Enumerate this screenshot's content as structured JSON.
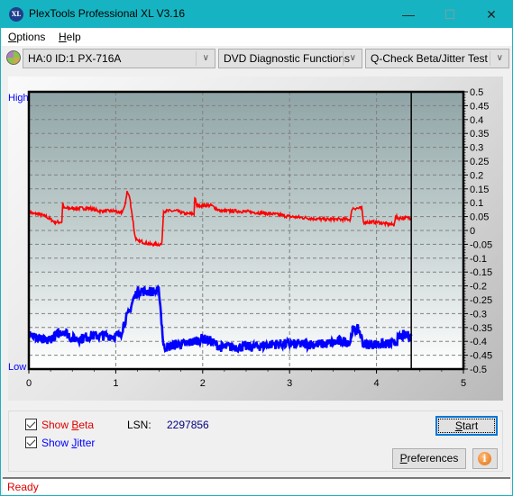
{
  "window": {
    "title": "PlexTools Professional XL V3.16",
    "app_icon_text": "XL",
    "minimize_glyph": "—",
    "maximize_glyph": "☐",
    "close_glyph": "✕"
  },
  "menu": {
    "items": [
      {
        "label": "Options",
        "mnemonic": "O",
        "rest": "ptions"
      },
      {
        "label": "Help",
        "mnemonic": "H",
        "rest": "elp"
      }
    ]
  },
  "toolbar": {
    "drive_select": "HA:0 ID:1  PX-716A",
    "function_select": "DVD Diagnostic Functions",
    "test_select": "Q-Check Beta/Jitter Test",
    "dropdown_glyph": "∨"
  },
  "chart_data": {
    "type": "line",
    "title": "",
    "xlabel": "",
    "ylabel_left_top": "High",
    "ylabel_left_bottom": "Low",
    "xlim": [
      0,
      5
    ],
    "ylim": [
      -0.5,
      0.5
    ],
    "x_ticks": [
      "0",
      "1",
      "2",
      "3",
      "4",
      "5"
    ],
    "x_tick_values": [
      0,
      1,
      2,
      3,
      4,
      5
    ],
    "y_ticks": [
      "0.5",
      "0.45",
      "0.4",
      "0.35",
      "0.3",
      "0.25",
      "0.2",
      "0.15",
      "0.1",
      "0.05",
      "0",
      "-0.05",
      "-0.1",
      "-0.15",
      "-0.2",
      "-0.25",
      "-0.3",
      "-0.35",
      "-0.4",
      "-0.45",
      "-0.5"
    ],
    "y_tick_values": [
      0.5,
      0.45,
      0.4,
      0.35,
      0.3,
      0.25,
      0.2,
      0.15,
      0.1,
      0.05,
      0,
      -0.05,
      -0.1,
      -0.15,
      -0.2,
      -0.25,
      -0.3,
      -0.35,
      -0.4,
      -0.45,
      -0.5
    ],
    "grid": true,
    "cursor_x": 4.4,
    "series": [
      {
        "name": "Beta",
        "color": "#ff0000",
        "x": [
          0.0,
          0.05,
          0.1,
          0.2,
          0.3,
          0.38,
          0.39,
          0.4,
          0.5,
          0.6,
          0.7,
          0.8,
          0.9,
          1.0,
          1.05,
          1.1,
          1.13,
          1.16,
          1.2,
          1.22,
          1.25,
          1.3,
          1.4,
          1.5,
          1.53,
          1.55,
          1.6,
          1.7,
          1.8,
          1.9,
          1.91,
          1.93,
          2.0,
          2.1,
          2.2,
          2.3,
          2.4,
          2.6,
          2.8,
          3.0,
          3.2,
          3.4,
          3.6,
          3.7,
          3.72,
          3.8,
          3.83,
          3.85,
          3.9,
          4.0,
          4.1,
          4.2,
          4.22,
          4.25,
          4.3,
          4.4
        ],
        "y": [
          0.07,
          0.06,
          0.06,
          0.05,
          0.03,
          0.03,
          0.1,
          0.08,
          0.08,
          0.08,
          0.08,
          0.07,
          0.07,
          0.07,
          0.06,
          0.08,
          0.14,
          0.12,
          0.03,
          -0.02,
          -0.04,
          -0.04,
          -0.05,
          -0.05,
          -0.05,
          0.07,
          0.07,
          0.07,
          0.06,
          0.06,
          0.12,
          0.09,
          0.09,
          0.09,
          0.07,
          0.07,
          0.07,
          0.065,
          0.06,
          0.05,
          0.045,
          0.04,
          0.04,
          0.04,
          0.08,
          0.08,
          0.08,
          0.03,
          0.03,
          0.03,
          0.025,
          0.02,
          0.05,
          0.045,
          0.045,
          0.045
        ]
      },
      {
        "name": "Jitter",
        "color": "#0000ff",
        "x": [
          0.0,
          0.05,
          0.1,
          0.2,
          0.3,
          0.4,
          0.5,
          0.6,
          0.7,
          0.8,
          0.9,
          1.0,
          1.05,
          1.1,
          1.15,
          1.2,
          1.25,
          1.3,
          1.4,
          1.5,
          1.52,
          1.55,
          1.6,
          1.7,
          1.8,
          1.9,
          2.0,
          2.1,
          2.2,
          2.4,
          2.6,
          2.8,
          3.0,
          3.2,
          3.4,
          3.6,
          3.7,
          3.72,
          3.78,
          3.8,
          3.85,
          3.9,
          4.0,
          4.1,
          4.2,
          4.25,
          4.3,
          4.4
        ],
        "y": [
          -0.36,
          -0.38,
          -0.39,
          -0.4,
          -0.38,
          -0.36,
          -0.39,
          -0.39,
          -0.38,
          -0.38,
          -0.38,
          -0.38,
          -0.38,
          -0.33,
          -0.3,
          -0.25,
          -0.22,
          -0.22,
          -0.22,
          -0.22,
          -0.3,
          -0.42,
          -0.42,
          -0.41,
          -0.41,
          -0.4,
          -0.39,
          -0.4,
          -0.42,
          -0.42,
          -0.42,
          -0.41,
          -0.41,
          -0.41,
          -0.41,
          -0.4,
          -0.4,
          -0.36,
          -0.36,
          -0.36,
          -0.41,
          -0.41,
          -0.41,
          -0.41,
          -0.41,
          -0.39,
          -0.38,
          -0.38
        ]
      }
    ]
  },
  "controls": {
    "show_beta_label": "Show Beta",
    "show_beta_pre": "Show ",
    "show_beta_mnemonic": "B",
    "show_beta_post": "eta",
    "show_beta_checked": true,
    "show_jitter_label": "Show Jitter",
    "show_jitter_pre": "Show ",
    "show_jitter_mnemonic": "J",
    "show_jitter_post": "itter",
    "show_jitter_checked": true,
    "lsn_label": "LSN:",
    "lsn_value": "2297856",
    "start_mnemonic": "S",
    "start_rest": "tart",
    "preferences_mnemonic": "P",
    "preferences_rest": "references",
    "info_glyph": "i"
  },
  "status": {
    "text": "Ready"
  },
  "colors": {
    "titlebar": "#16b4c2",
    "beta": "#ff0000",
    "jitter": "#0000ff",
    "axis_label": "#0000ff",
    "lsn_value": "#000080",
    "status_text": "#e00000"
  }
}
